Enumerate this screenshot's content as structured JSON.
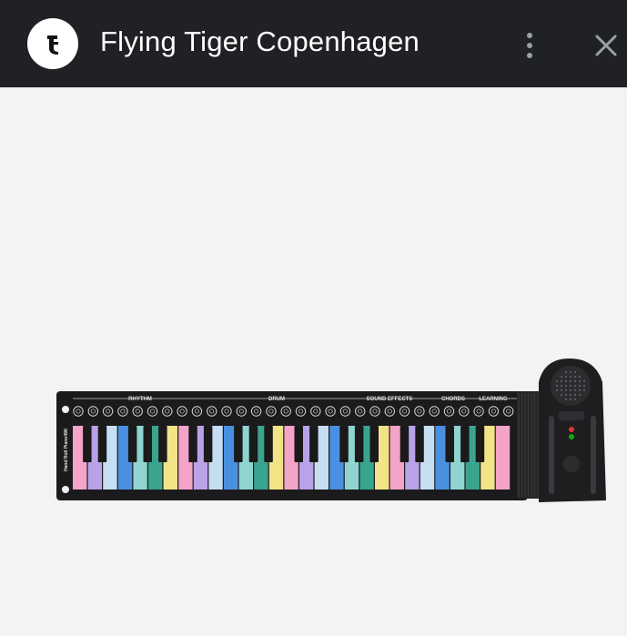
{
  "header": {
    "title": "Flying Tiger Copenhagen",
    "logo_icon": "flying-tiger-logo-icon",
    "menu_icon": "more-vertical-icon",
    "close_icon": "close-icon"
  },
  "product": {
    "sections": [
      "RHYTHM",
      "DRUM",
      "SOUND EFFECTS",
      "CHORDS",
      "LEARNING"
    ],
    "side_label": "Hand Roll Piano49K",
    "key_colors": [
      "#f4a3c9",
      "#b9a2e8",
      "#c6def2",
      "#4a90e0",
      "#8fd4d0",
      "#3aa48e",
      "#f2e486"
    ]
  },
  "colors": {
    "appbar": "#202124",
    "background": "#f3f3f3"
  }
}
